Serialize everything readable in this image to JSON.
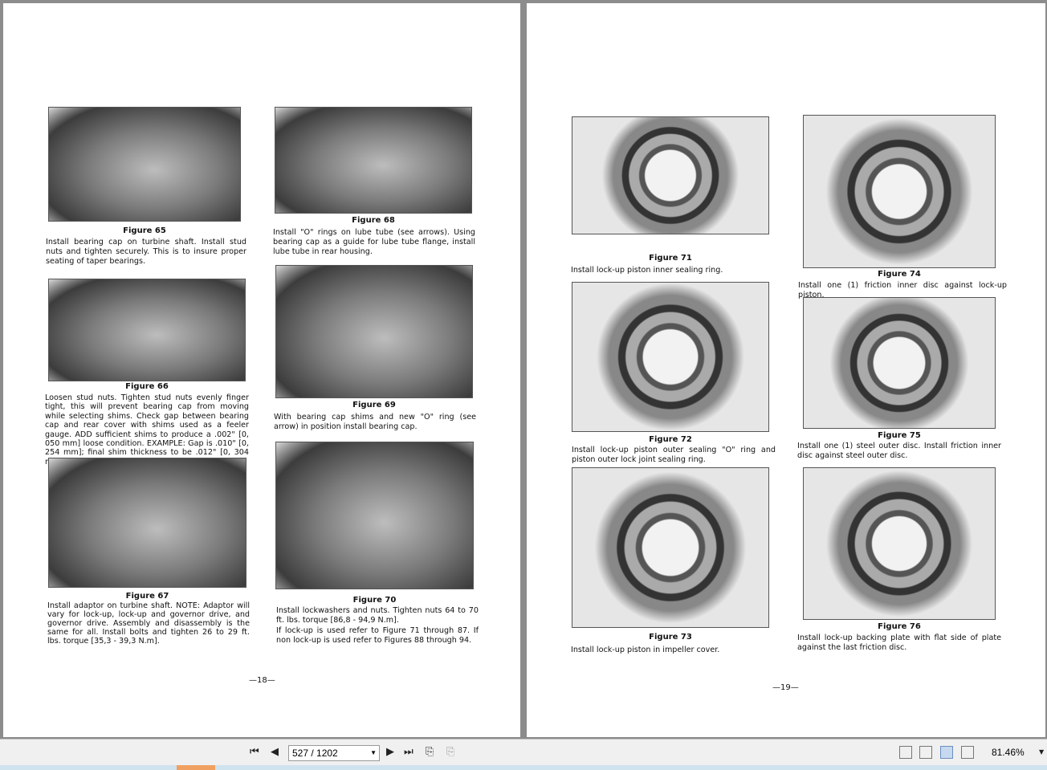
{
  "left_page": {
    "page_number": "—18—",
    "figures": [
      {
        "label": "Figure 65",
        "caption": "Install bearing cap on turbine shaft. Install stud nuts and tighten securely. This is to insure proper seating of taper bearings."
      },
      {
        "label": "Figure 66",
        "caption": "Loosen stud nuts. Tighten stud nuts evenly finger tight, this will prevent bearing cap from moving while selecting shims. Check gap between bearing cap and rear cover with shims used as a feeler gauge. ADD sufficient shims to produce a .002\" [0, 050 mm] loose condition. EXAMPLE: Gap is .010\" [0, 254 mm]; final shim thickness to be .012\" [0, 304 mm]. Remove bearing cap."
      },
      {
        "label": "Figure 67",
        "caption": "Install adaptor on turbine shaft. NOTE: Adaptor will vary for lock-up, lock-up and governor drive, and governor drive. Assembly and disassembly is the same for all. Install bolts and tighten 26 to 29 ft. lbs. torque [35,3 - 39,3 N.m]."
      },
      {
        "label": "Figure 68",
        "caption": "Install \"O\" rings on lube tube (see arrows). Using bearing cap as a guide for lube tube flange, install lube tube in rear housing."
      },
      {
        "label": "Figure 69",
        "caption": "With bearing cap shims and new \"O\" ring (see arrow) in position install bearing cap."
      },
      {
        "label": "Figure 70",
        "caption": "Install lockwashers and nuts. Tighten nuts 64 to 70 ft. lbs. torque [86,8 - 94,9 N.m].",
        "caption2": "If lock-up is used refer to Figure 71 through 87. If non lock-up is used refer to Figures 88 through 94."
      }
    ]
  },
  "right_page": {
    "page_number": "—19—",
    "figures": [
      {
        "label": "Figure 71",
        "caption": "Install lock-up piston inner sealing ring."
      },
      {
        "label": "Figure 72",
        "caption": "Install lock-up piston outer sealing \"O\" ring and piston outer lock joint sealing ring."
      },
      {
        "label": "Figure 73",
        "caption": "Install lock-up piston in impeller cover."
      },
      {
        "label": "Figure 74",
        "caption": "Install one (1) friction inner disc against lock-up piston."
      },
      {
        "label": "Figure 75",
        "caption": "Install one (1) steel outer disc. Install friction inner disc against steel outer disc."
      },
      {
        "label": "Figure 76",
        "caption": "Install lock-up backing plate with flat side of plate against the last friction disc."
      }
    ]
  },
  "toolbar": {
    "page_indicator": "527 / 1202",
    "zoom": "81.46%",
    "icons": [
      "first-page-icon",
      "prev-page-icon",
      "next-page-icon",
      "last-page-icon",
      "previous-view-icon",
      "next-view-icon",
      "single-page-icon",
      "continuous-icon",
      "facing-icon",
      "continuous-facing-icon"
    ]
  }
}
